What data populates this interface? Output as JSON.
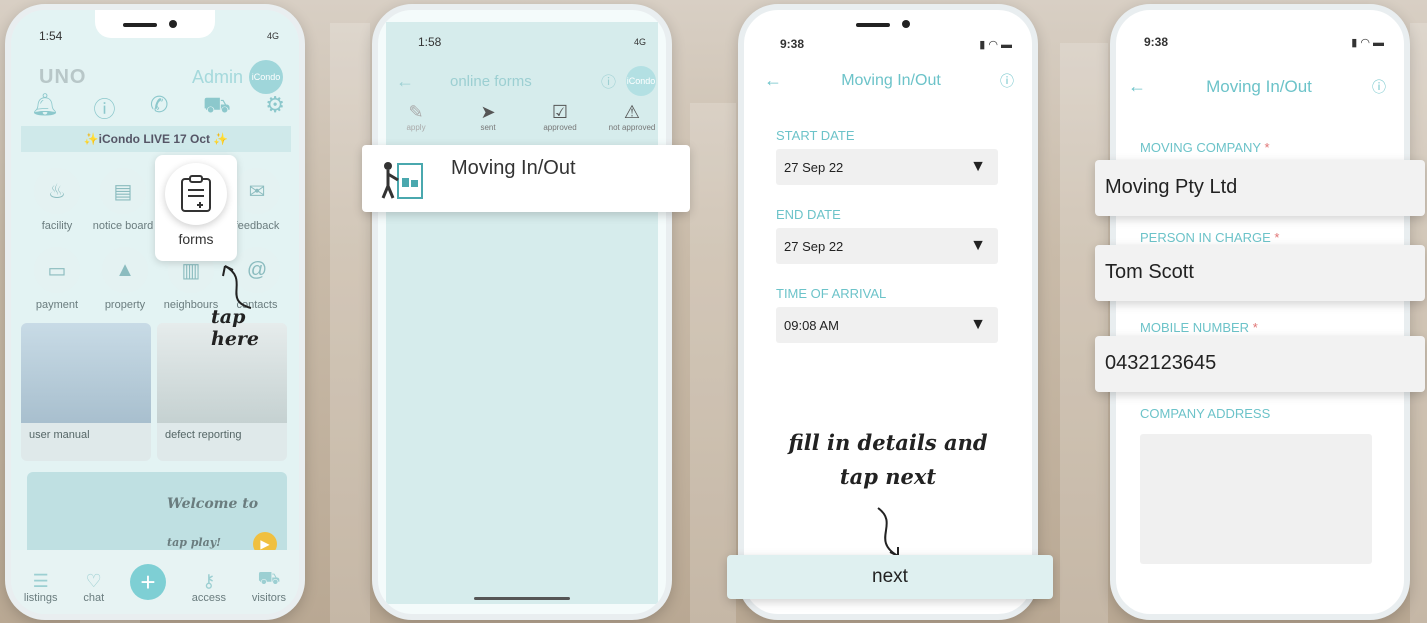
{
  "phone1": {
    "time": "1:54",
    "network": "4G",
    "brand": "UNO",
    "role": "Admin",
    "avatar_text": "iCondo",
    "banner": "✨iCondo LIVE 17 Oct ✨",
    "grid_row1": [
      "facility",
      "notice board",
      "feedback"
    ],
    "grid_row2": [
      "payment",
      "property",
      "neighbours",
      "contacts"
    ],
    "forms_label": "forms",
    "tap_note": "tap here",
    "cards": [
      "user manual",
      "defect reporting"
    ],
    "welcome_text": "Welcome to",
    "welcome_sub": "tap play!",
    "tabs": [
      "listings",
      "chat",
      "access",
      "visitors"
    ]
  },
  "phone2": {
    "time": "1:58",
    "network": "4G",
    "title": "online forms",
    "avatar_text": "iCondo",
    "tabs": [
      "apply",
      "sent",
      "approved",
      "not approved"
    ],
    "callout_label": "Moving In/Out"
  },
  "phone3": {
    "time": "9:38",
    "title": "Moving In/Out",
    "start_label": "START DATE",
    "start_value": "27 Sep 22",
    "end_label": "END DATE",
    "end_value": "27 Sep 22",
    "arrival_label": "TIME OF ARRIVAL",
    "arrival_value": "09:08 AM",
    "note_line1": "fill in details and",
    "note_line2": "tap next",
    "next_label": "next"
  },
  "phone4": {
    "time": "9:38",
    "title": "Moving In/Out",
    "company_label": "MOVING COMPANY",
    "company_value": "Moving Pty Ltd",
    "person_label": "PERSON IN CHARGE",
    "person_value": "Tom Scott",
    "mobile_label": "MOBILE NUMBER",
    "mobile_value": "0432123645",
    "address_label": "COMPANY ADDRESS",
    "required_mark": "*"
  },
  "colors": {
    "accent": "#6cc3c9",
    "required": "#e07474"
  },
  "icons": [
    "bell-icon",
    "info-icon",
    "phone-icon",
    "car-icon",
    "gear-icon",
    "back-arrow-icon",
    "help-icon",
    "dropdown-arrow-icon"
  ]
}
